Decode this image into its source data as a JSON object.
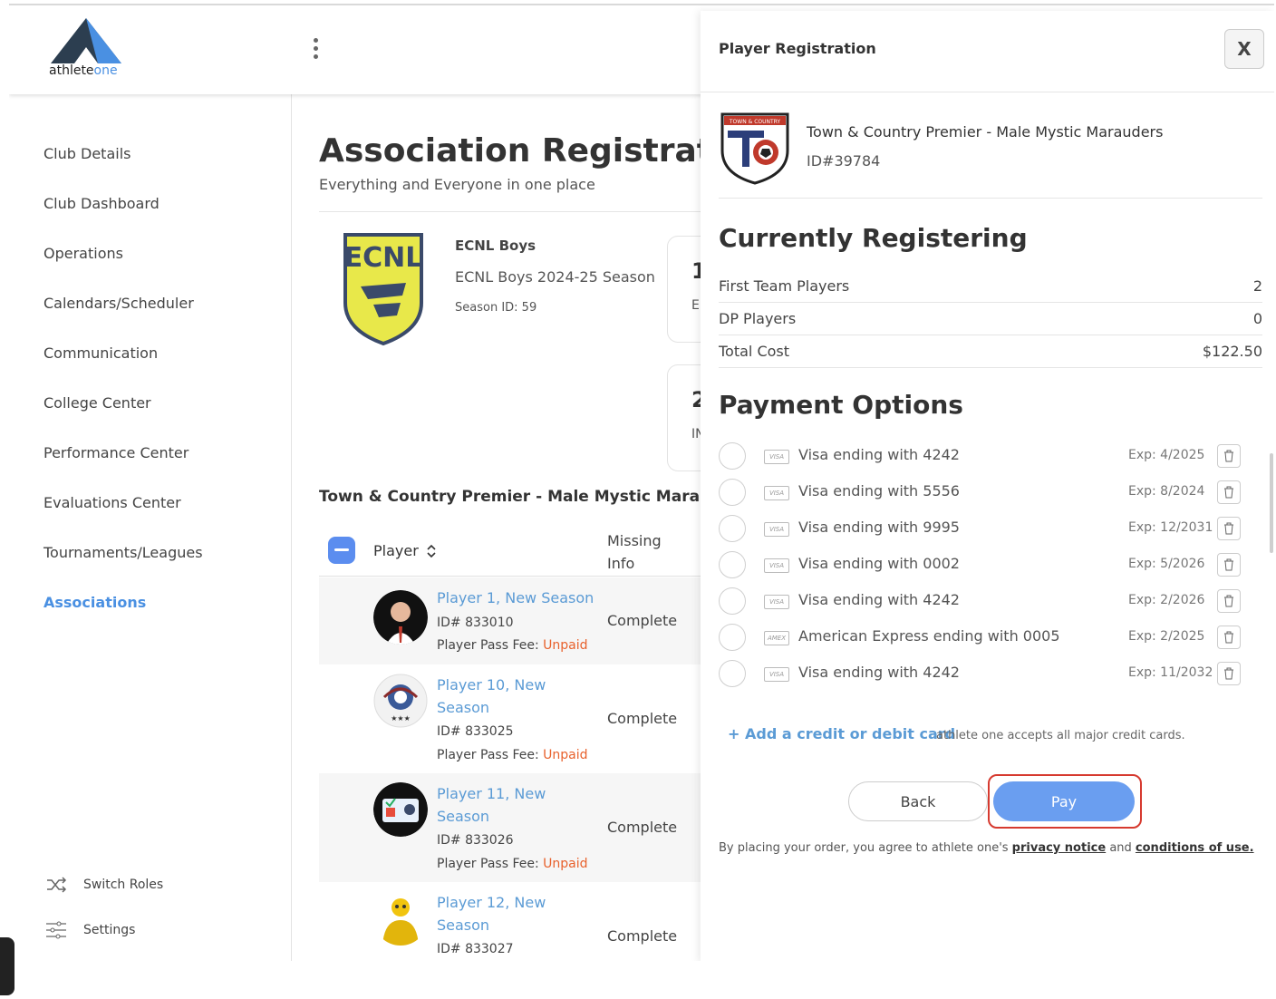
{
  "brand": {
    "logo_word": "athlete",
    "logo_accent": "one",
    "accent": "#4a90e2"
  },
  "sidebar": {
    "items": [
      {
        "label": "Club Details"
      },
      {
        "label": "Club Dashboard"
      },
      {
        "label": "Operations"
      },
      {
        "label": "Calendars/Scheduler"
      },
      {
        "label": "Communication"
      },
      {
        "label": "College Center"
      },
      {
        "label": "Performance Center"
      },
      {
        "label": "Evaluations Center"
      },
      {
        "label": "Tournaments/Leagues"
      },
      {
        "label": "Associations",
        "active": true
      }
    ],
    "footer": [
      {
        "label": "Switch Roles",
        "icon": "shuffle-icon"
      },
      {
        "label": "Settings",
        "icon": "sliders-icon"
      }
    ]
  },
  "main": {
    "title": "Association Registration",
    "subtitle": "Everything and Everyone in one place",
    "season": {
      "name": "ECNL Boys",
      "full": "ECNL Boys 2024-25 Season",
      "id_label": "Season ID: 59",
      "logo_text": "ECNL"
    },
    "stat_cards": [
      {
        "num": "1",
        "label": "E"
      },
      {
        "num": "2",
        "label": "IN"
      }
    ],
    "team_title": "Town & Country Premier - Male Mystic Marauders",
    "table": {
      "col_player": "Player",
      "col_missing": [
        "Missing",
        "Info"
      ],
      "rows": [
        {
          "name_lines": [
            "Player 1, New Season"
          ],
          "id": "ID# 833010",
          "fee_label": "Player Pass Fee: ",
          "fee_status": "Unpaid",
          "status": "Complete"
        },
        {
          "name_lines": [
            "Player 10, New",
            "Season"
          ],
          "id": "ID# 833025",
          "fee_label": "Player Pass Fee: ",
          "fee_status": "Unpaid",
          "status": "Complete"
        },
        {
          "name_lines": [
            "Player 11, New",
            "Season"
          ],
          "id": "ID# 833026",
          "fee_label": "Player Pass Fee: ",
          "fee_status": "Unpaid",
          "status": "Complete"
        },
        {
          "name_lines": [
            "Player 12, New",
            "Season"
          ],
          "id": "ID# 833027",
          "status": "Complete"
        }
      ]
    }
  },
  "panel": {
    "title": "Player Registration",
    "close_label": "X",
    "team": {
      "name": "Town & Country Premier - Male Mystic Marauders",
      "id": "ID#39784",
      "logo_banner": "TOWN & COUNTRY"
    },
    "currently_registering": {
      "title": "Currently Registering",
      "rows": [
        {
          "label": "First Team Players",
          "value": "2"
        },
        {
          "label": "DP Players",
          "value": "0"
        },
        {
          "label": "Total Cost",
          "value": "$122.50"
        }
      ]
    },
    "payment": {
      "title": "Payment Options",
      "cards": [
        {
          "label": "Visa ending with 4242",
          "exp": "Exp: 4/2025",
          "brand": "VISA"
        },
        {
          "label": "Visa ending with 5556",
          "exp": "Exp: 8/2024",
          "brand": "VISA"
        },
        {
          "label": "Visa ending with 9995",
          "exp": "Exp: 12/2031",
          "brand": "VISA"
        },
        {
          "label": "Visa ending with 0002",
          "exp": "Exp: 5/2026",
          "brand": "VISA"
        },
        {
          "label": "Visa ending with 4242",
          "exp": "Exp: 2/2026",
          "brand": "VISA"
        },
        {
          "label": "American Express ending with 0005",
          "exp": "Exp: 2/2025",
          "brand": "AMEX"
        },
        {
          "label": "Visa ending with 4242",
          "exp": "Exp: 11/2032",
          "brand": "VISA"
        }
      ],
      "add_card": "+ Add a credit or debit card",
      "accepts": "athlete one accepts all major credit cards."
    },
    "back_label": "Back",
    "pay_label": "Pay",
    "legal": {
      "prefix": "By placing your order, you agree to athlete one's ",
      "privacy": "privacy notice",
      "and": " and ",
      "terms": "conditions of use."
    }
  }
}
